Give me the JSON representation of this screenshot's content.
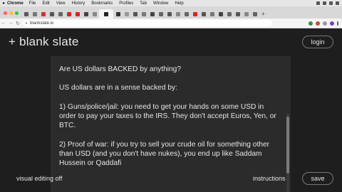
{
  "menubar": {
    "app_name": "Chrome",
    "items": [
      "File",
      "Edit",
      "View",
      "History",
      "Bookmarks",
      "Profiles",
      "Tab",
      "Window",
      "Help"
    ]
  },
  "browser": {
    "url": "blankslate.io",
    "new_tab_symbol": "+"
  },
  "app": {
    "brand": "+ blank slate",
    "login_label": "login",
    "visual_editing_label": "visual editing off",
    "instructions_label": "instructions",
    "save_label": "save"
  },
  "editor": {
    "content": "Are US dollars BACKED by anything?\n\nUS dollars are in a sense backed by:\n\n1) Guns/police/jail: you need to get your hands on some USD in order to pay your taxes to the IRS. They don't accept Euros, Yen, or BTC.\n\n2) Proof of war: if you try to sell your crude oil for something other than USD (and you don't have nukes), you end up like Saddam Hussein or Qaddafi"
  },
  "colors": {
    "page_bg": "#1e1e1e",
    "editor_bg": "#2b2b2b",
    "text": "#e6e6e6"
  }
}
